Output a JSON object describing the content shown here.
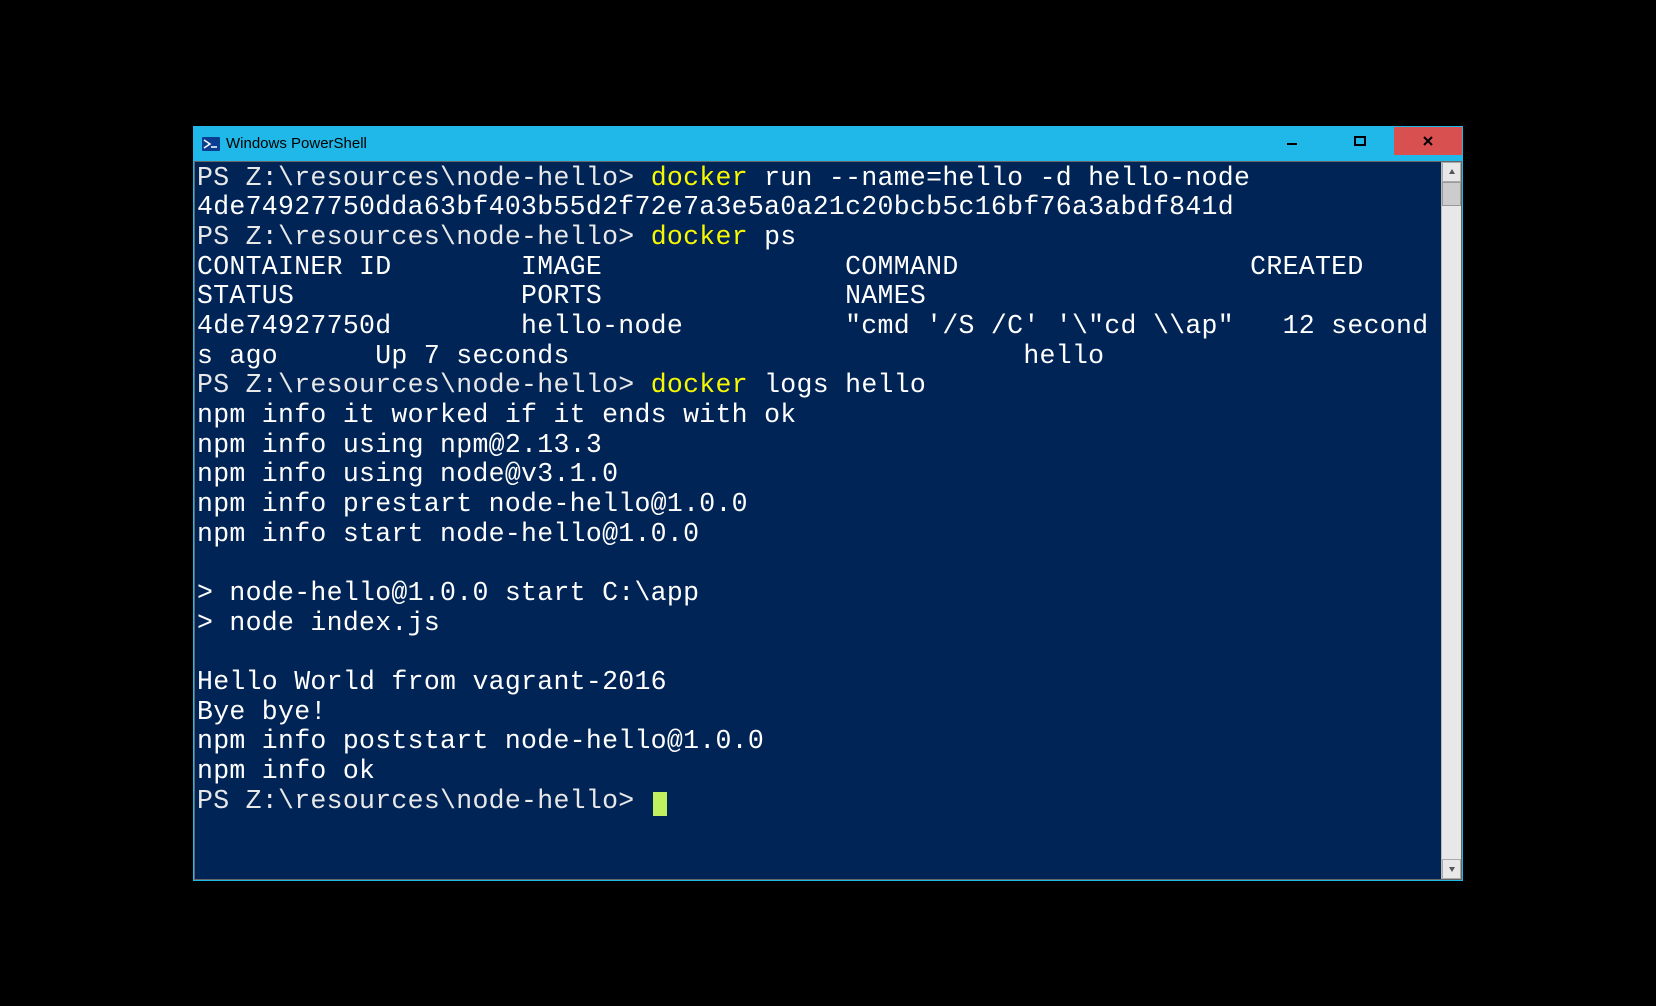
{
  "window": {
    "title": "Windows PowerShell"
  },
  "prompt": "PS Z:\\resources\\node-hello> ",
  "cmd1": {
    "docker": "docker",
    "rest1": " run --name=hello ",
    "flag": "-d",
    "rest2": " hello-node"
  },
  "out1": "4de74927750dda63bf403b55d2f72e7a3e5a0a21c20bcb5c16bf76a3abdf841d",
  "cmd2": {
    "docker": "docker",
    "rest": " ps"
  },
  "ps_header": "CONTAINER ID        IMAGE               COMMAND                  CREATED             STATUS              PORTS               NAMES",
  "ps_row": "4de74927750d        hello-node          \"cmd '/S /C' '\\\"cd \\\\ap\"   12 seconds ago      Up 7 seconds                            hello",
  "cmd3": {
    "docker": "docker",
    "rest": " logs hello"
  },
  "logs": [
    "npm info it worked if it ends with ok",
    "npm info using npm@2.13.3",
    "npm info using node@v3.1.0",
    "npm info prestart node-hello@1.0.0",
    "npm info start node-hello@1.0.0",
    "",
    "> node-hello@1.0.0 start C:\\app",
    "> node index.js",
    "",
    "Hello World from vagrant-2016",
    "Bye bye!",
    "npm info poststart node-hello@1.0.0",
    "npm info ok"
  ]
}
